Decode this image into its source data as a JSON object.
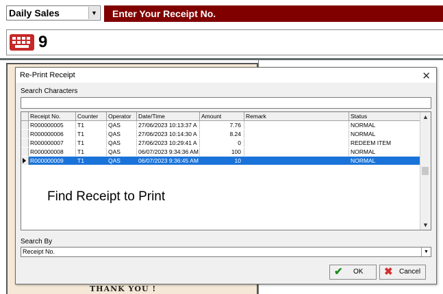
{
  "app": {
    "mode_select": "Daily Sales",
    "receipt_prompt": "Enter Your Receipt No.",
    "receipt_number": "9",
    "paper_footer": "THANK YOU !"
  },
  "dialog": {
    "title": "Re-Print Receipt",
    "search_label": "Search Characters",
    "search_value": "",
    "columns": [
      "Receipt No.",
      "Counter",
      "Operator",
      "Date/Time",
      "Amount",
      "Remark",
      "Status"
    ],
    "rows": [
      {
        "receipt": "R000000005",
        "counter": "T1",
        "operator": "QAS",
        "datetime": "27/06/2023 10:13:37 A",
        "amount": "7.76",
        "remark": "",
        "status": "NORMAL"
      },
      {
        "receipt": "R000000006",
        "counter": "T1",
        "operator": "QAS",
        "datetime": "27/06/2023 10:14:30 A",
        "amount": "8.24",
        "remark": "",
        "status": "NORMAL"
      },
      {
        "receipt": "R000000007",
        "counter": "T1",
        "operator": "QAS",
        "datetime": "27/06/2023 10:29:41 A",
        "amount": "0",
        "remark": "",
        "status": "REDEEM ITEM"
      },
      {
        "receipt": "R000000008",
        "counter": "T1",
        "operator": "QAS",
        "datetime": "06/07/2023 9:34:36 AM",
        "amount": "100",
        "remark": "",
        "status": "NORMAL"
      },
      {
        "receipt": "R000000009",
        "counter": "T1",
        "operator": "QAS",
        "datetime": "06/07/2023 9:36:45 AM",
        "amount": "10",
        "remark": "",
        "status": "NORMAL"
      }
    ],
    "selected_row": 4,
    "overlay_text": "Find Receipt to Print",
    "search_by_label": "Search By",
    "search_by_value": "Receipt No.",
    "ok_label": "OK",
    "cancel_label": "Cancel"
  },
  "colors": {
    "receipt_bar": "#800000",
    "selection": "#1a73d9",
    "ok_icon": "#1b8a1b",
    "cancel_icon": "#d32f2f",
    "keyboard_icon": "#c62828"
  },
  "icons": [
    "keyboard-icon",
    "close-icon",
    "row-pointer-icon",
    "checkmark-icon",
    "x-icon",
    "dropdown-arrow-icon"
  ]
}
